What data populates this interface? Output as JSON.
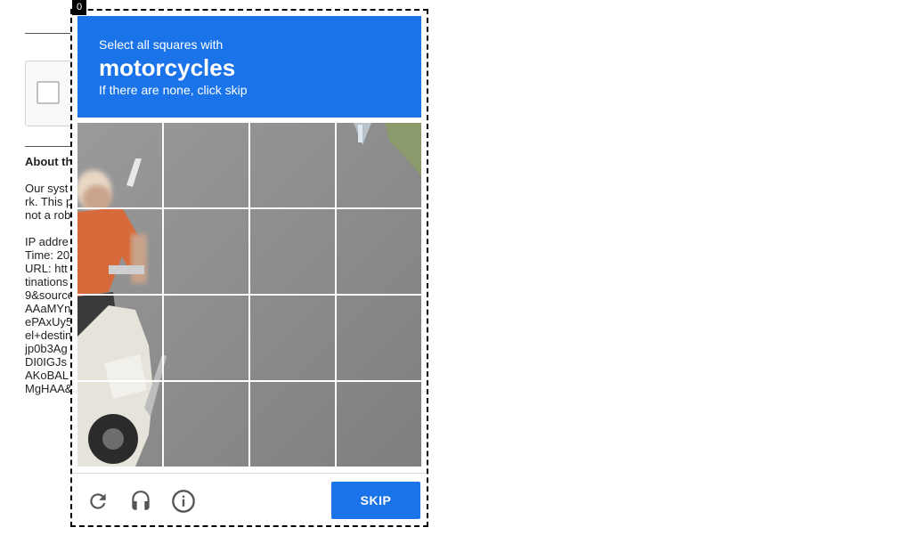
{
  "background_page": {
    "heading": "About th",
    "lines": [
      "Our syst",
      "rk. This p",
      "not a rob",
      "",
      "IP addre",
      "Time: 20",
      "URL: htt",
      "tinations",
      "9&source",
      "AAaMYn",
      "ePAxUy5",
      "el+destin",
      "jp0b3Ag",
      "DI0IGJs",
      "AKoBAL",
      "MgHAA&"
    ]
  },
  "challenge": {
    "frame_index": "0",
    "instruction_prefix": "Select all squares with",
    "target_object": "motorcycles",
    "instruction_suffix": "If there are none, click skip",
    "grid_rows": 4,
    "grid_cols": 4,
    "skip_label": "SKIP",
    "icons": [
      "reload-icon",
      "audio-icon",
      "info-icon"
    ],
    "accent_color": "#1a73e8"
  }
}
